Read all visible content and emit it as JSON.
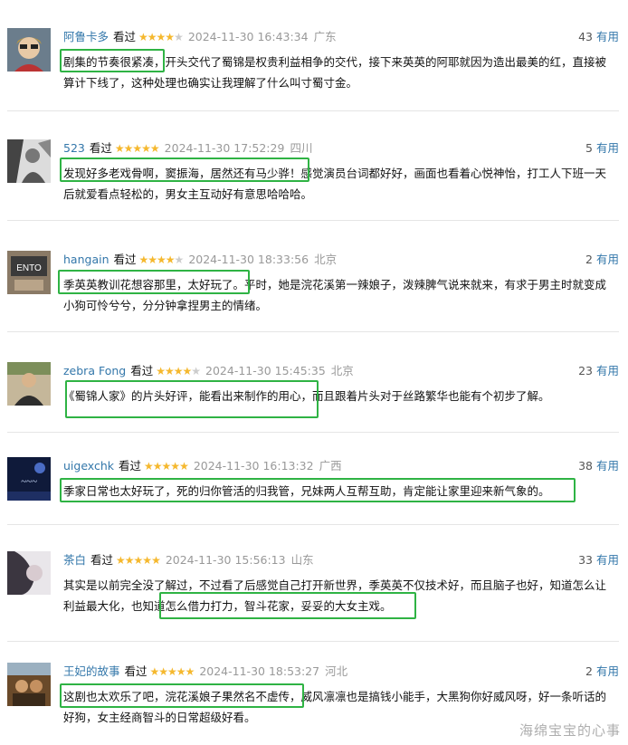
{
  "reviews": [
    {
      "user": "阿鲁卡多",
      "watched": "看过",
      "stars": 4,
      "time": "2024-11-30 16:43:34",
      "location": "广东",
      "useful_count": "43",
      "useful_label": "有用",
      "content": "剧集的节奏很紧凑，开头交代了蜀锦是权贵利益相争的交代，接下来英英的阿耶就因为造出最美的红，直接被算计下线了，这种处理也确实让我理解了什么叫寸蜀寸金。"
    },
    {
      "user": "523",
      "watched": "看过",
      "stars": 5,
      "time": "2024-11-30 17:52:29",
      "location": "四川",
      "useful_count": "5",
      "useful_label": "有用",
      "content": "发现好多老戏骨啊，窦振海，居然还有马少骅！感觉演员台词都好好，画面也看着心悦神怡，打工人下班一天后就爱看点轻松的，男女主互动好有意思哈哈哈。"
    },
    {
      "user": "hangain",
      "watched": "看过",
      "stars": 4,
      "time": "2024-11-30 18:33:56",
      "location": "北京",
      "useful_count": "2",
      "useful_label": "有用",
      "content": "季英英教训花想容那里，太好玩了。平时，她是浣花溪第一辣娘子，泼辣脾气说来就来，有求于男主时就变成小狗可怜兮兮，分分钟拿捏男主的情绪。"
    },
    {
      "user": "zebra Fong",
      "watched": "看过",
      "stars": 4,
      "time": "2024-11-30 15:45:35",
      "location": "北京",
      "useful_count": "23",
      "useful_label": "有用",
      "content": "《蜀锦人家》的片头好评，能看出来制作的用心，而且跟着片头对于丝路繁华也能有个初步了解。"
    },
    {
      "user": "uigexchk",
      "watched": "看过",
      "stars": 5,
      "time": "2024-11-30 16:13:32",
      "location": "广西",
      "useful_count": "38",
      "useful_label": "有用",
      "content": "季家日常也太好玩了，死的归你管活的归我管，兄妹两人互帮互助，肯定能让家里迎来新气象的。"
    },
    {
      "user": "茶白",
      "watched": "看过",
      "stars": 5,
      "time": "2024-11-30 15:56:13",
      "location": "山东",
      "useful_count": "33",
      "useful_label": "有用",
      "content": "其实是以前完全没了解过，不过看了后感觉自己打开新世界，季英英不仅技术好，而且脑子也好，知道怎么让利益最大化，也知道怎么借力打力，智斗花家，妥妥的大女主戏。"
    },
    {
      "user": "王妃的故事",
      "watched": "看过",
      "stars": 5,
      "time": "2024-11-30 18:53:27",
      "location": "河北",
      "useful_count": "2",
      "useful_label": "有用",
      "content": "这剧也太欢乐了吧，浣花溪娘子果然名不虚传，威风凛凛也是搞钱小能手，大黑狗你好威风呀，好一条听话的好狗，女主经商智斗的日常超级好看。"
    }
  ],
  "watermark": "海绵宝宝的心事",
  "colors": {
    "username": "#3377aa",
    "star": "#f5b82e",
    "highlight": "#2fb344",
    "meta_gray": "#999999"
  }
}
